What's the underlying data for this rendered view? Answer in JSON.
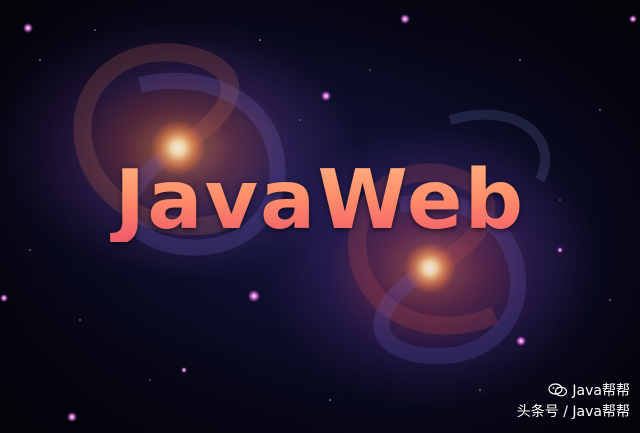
{
  "image": {
    "title": "JavaWeb",
    "watermark": {
      "icon": "wechat-icon",
      "account": "Java帮帮",
      "line2": "头条号 / Java帮帮"
    },
    "colors": {
      "title_top": "#ffb080",
      "title_bottom": "#f05a6a",
      "galaxy_core": "#ffe0a0",
      "sky": "#070718"
    }
  }
}
